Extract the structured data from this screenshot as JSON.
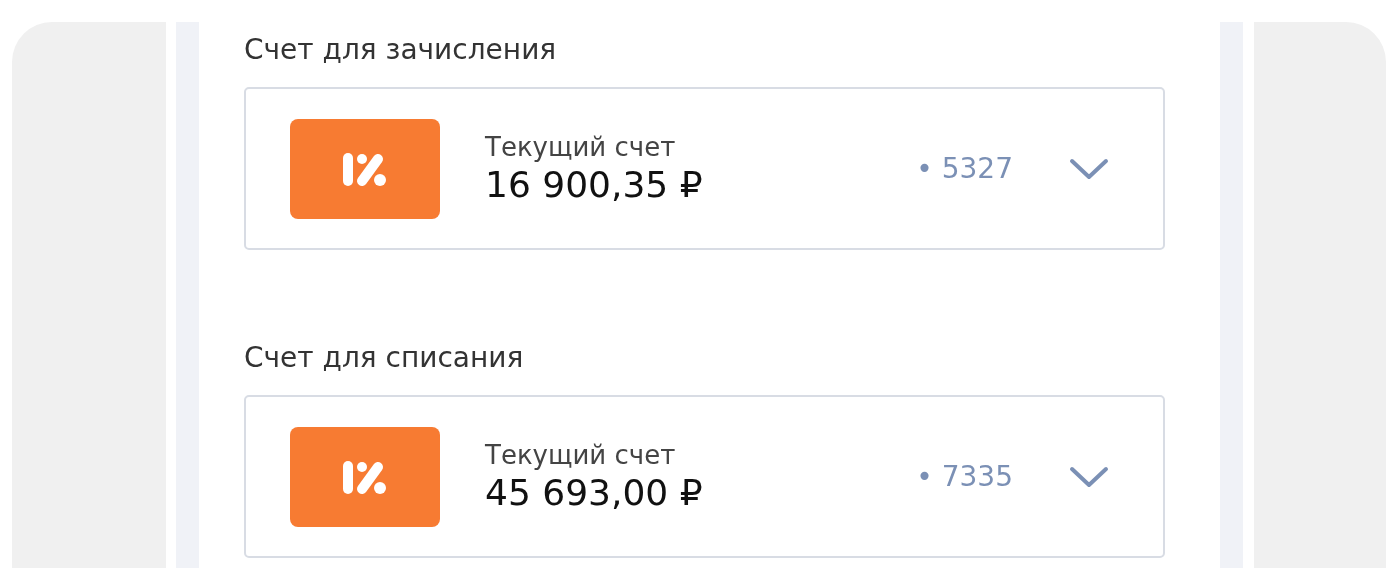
{
  "accounts": [
    {
      "label": "Счет для зачисления",
      "account_name": "Текущий счет",
      "balance": "16 900,35 ₽",
      "number": "• 5327"
    },
    {
      "label": "Счет для списания",
      "account_name": "Текущий счет",
      "balance": "45 693,00 ₽",
      "number": "• 7335"
    }
  ]
}
